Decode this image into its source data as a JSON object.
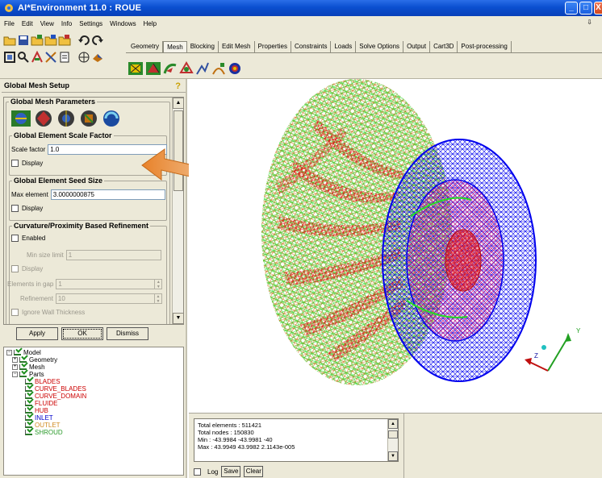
{
  "window": {
    "title": "AI*Environment 11.0 : ROUE",
    "buttons": [
      "_",
      "□",
      "X"
    ]
  },
  "menu": [
    "File",
    "Edit",
    "View",
    "Info",
    "Settings",
    "Windows",
    "Help"
  ],
  "menu_right": "⇩",
  "tabs": [
    "Geometry",
    "Mesh",
    "Blocking",
    "Edit Mesh",
    "Properties",
    "Constraints",
    "Loads",
    "Solve Options",
    "Output",
    "Cart3D",
    "Post-processing"
  ],
  "active_tab": "Mesh",
  "panel": {
    "title": "Global Mesh Setup",
    "params_group": "Global Mesh Parameters",
    "scale_group": "Global Element Scale Factor",
    "scale_label": "Scale factor",
    "scale_value": "1.0",
    "display_label": "Display",
    "seed_group": "Global Element Seed Size",
    "max_label": "Max element",
    "max_value": "3.0000000875",
    "curv_group": "Curvature/Proximity Based Refinement",
    "enabled_label": "Enabled",
    "min_size_label": "Min size limit",
    "min_size_value": "1",
    "elements_gap_label": "Elements in gap",
    "elements_gap_value": "1",
    "refinement_label": "Refinement",
    "refinement_value": "10",
    "ignore_wall_label": "Ignore Wall Thickness",
    "apply": "Apply",
    "ok": "OK",
    "dismiss": "Dismiss"
  },
  "tree": {
    "model": "Model",
    "geometry": "Geometry",
    "mesh": "Mesh",
    "parts": "Parts",
    "part_items": [
      {
        "name": "BLADES",
        "color": "#cc0000"
      },
      {
        "name": "CURVE_BLADES",
        "color": "#cc0000"
      },
      {
        "name": "CURVE_DOMAIN",
        "color": "#cc0000"
      },
      {
        "name": "FLUIDE",
        "color": "#cc0000"
      },
      {
        "name": "HUB",
        "color": "#cc0000"
      },
      {
        "name": "INLET",
        "color": "#0000cc"
      },
      {
        "name": "OUTLET",
        "color": "#d08a20"
      },
      {
        "name": "SHROUD",
        "color": "#2a9a2a"
      }
    ]
  },
  "messages": {
    "line1": "Total elements : 511421",
    "line2": "Total nodes : 150830",
    "line3": "Min : -43.9984 -43.9981 -40",
    "line4": "Max : 43.9949 43.9982 2.1143e-005",
    "log": "Log",
    "save": "Save",
    "clear": "Clear"
  },
  "axes": {
    "y": "Y",
    "z": "Z",
    "x": "X"
  },
  "colors": {
    "title_bar": "#0a4fd0",
    "panel_bg": "#ece9d8",
    "mesh_green": "#22dd22",
    "mesh_red": "#e01010",
    "mesh_orange": "#c8741a",
    "mesh_blue": "#0000ee",
    "mesh_magenta": "#cc2288",
    "arrow": "#d2691e"
  }
}
